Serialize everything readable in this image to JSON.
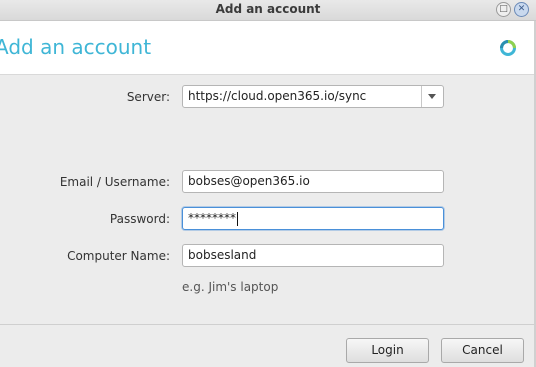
{
  "window": {
    "title": "Add an account"
  },
  "header": {
    "heading": "Add an account",
    "logo_icon": "app-logo-icon"
  },
  "form": {
    "server": {
      "label": "Server:",
      "value": "https://cloud.open365.io/sync"
    },
    "email": {
      "label": "Email / Username:",
      "value": "bobses@open365.io"
    },
    "password": {
      "label": "Password:",
      "value": "********"
    },
    "computer": {
      "label": "Computer Name:",
      "value": "bobsesland",
      "hint": "e.g. Jim's laptop"
    }
  },
  "buttons": {
    "login": "Login",
    "cancel": "Cancel"
  },
  "colors": {
    "accent": "#3fb6d6",
    "focus": "#4a90d9"
  }
}
